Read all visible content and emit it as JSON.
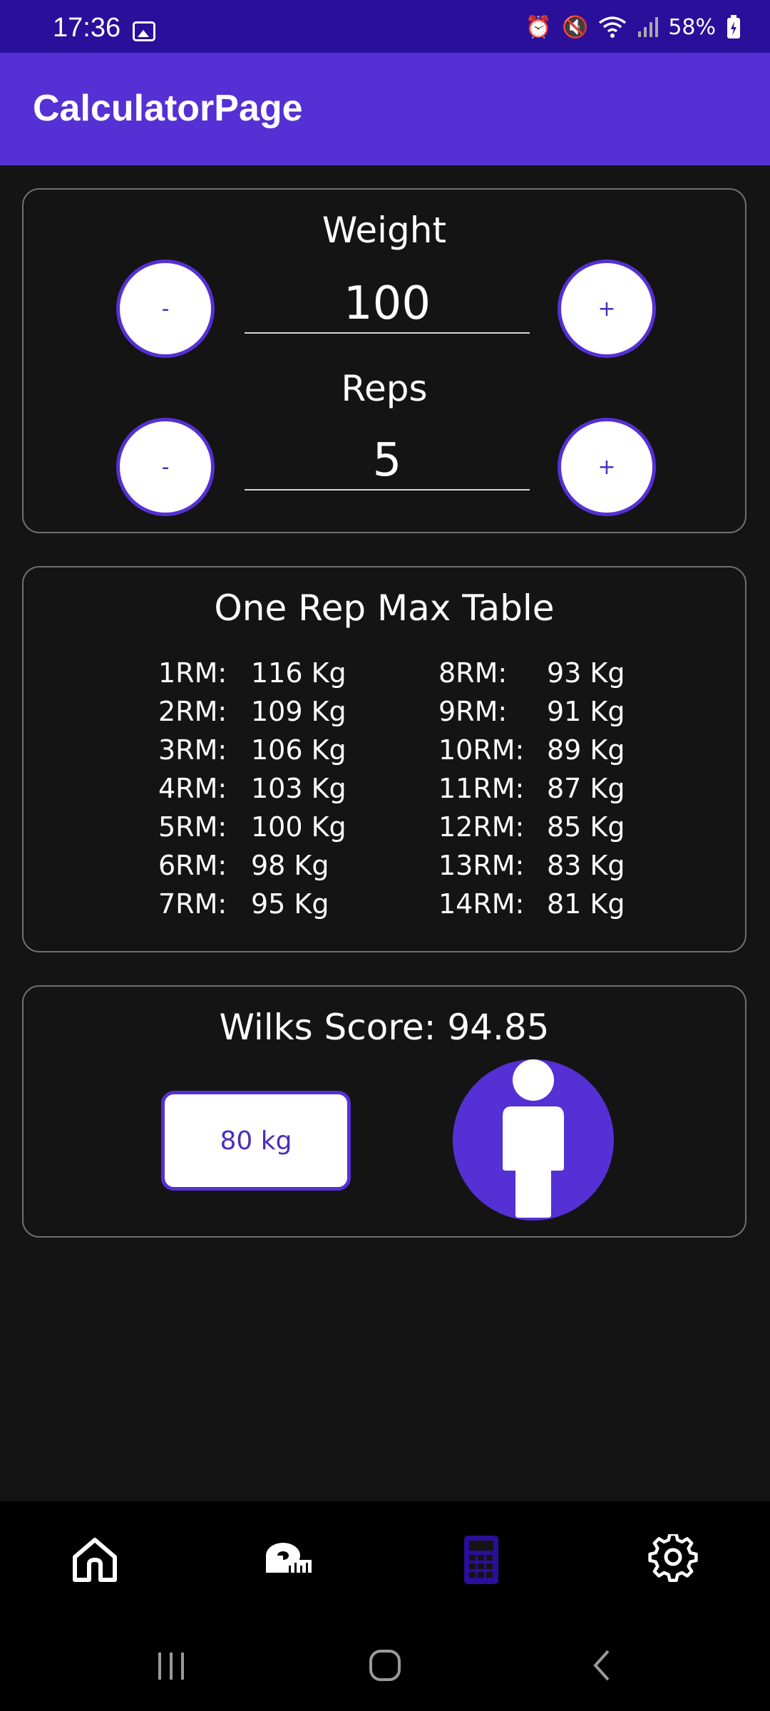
{
  "status_bar": {
    "time": "17:36",
    "battery": "58%"
  },
  "app_bar": {
    "title": "CalculatorPage"
  },
  "inputs_card": {
    "weight": {
      "label": "Weight",
      "value": "100",
      "minus": "-",
      "plus": "+"
    },
    "reps": {
      "label": "Reps",
      "value": "5",
      "minus": "-",
      "plus": "+"
    }
  },
  "rm_table": {
    "title": "One Rep Max Table",
    "left": [
      {
        "label": "1RM:",
        "value": "116 Kg"
      },
      {
        "label": "2RM:",
        "value": "109 Kg"
      },
      {
        "label": "3RM:",
        "value": "106 Kg"
      },
      {
        "label": "4RM:",
        "value": "103 Kg"
      },
      {
        "label": "5RM:",
        "value": "100 Kg"
      },
      {
        "label": "6RM:",
        "value": "98 Kg"
      },
      {
        "label": "7RM:",
        "value": "95 Kg"
      }
    ],
    "right": [
      {
        "label": "8RM:",
        "value": "93 Kg"
      },
      {
        "label": "9RM:",
        "value": "91 Kg"
      },
      {
        "label": "10RM:",
        "value": "89 Kg"
      },
      {
        "label": "11RM:",
        "value": "87 Kg"
      },
      {
        "label": "12RM:",
        "value": "85 Kg"
      },
      {
        "label": "13RM:",
        "value": "83 Kg"
      },
      {
        "label": "14RM:",
        "value": "81 Kg"
      }
    ]
  },
  "wilks": {
    "score_text": "Wilks Score: 94.85",
    "bodyweight_button": "80 kg",
    "gender_icon": "male-person-icon"
  },
  "bottom_nav": {
    "items": [
      {
        "icon": "home-icon",
        "active": false
      },
      {
        "icon": "measuring-tape-icon",
        "active": false
      },
      {
        "icon": "calculator-icon",
        "active": true
      },
      {
        "icon": "settings-gear-icon",
        "active": false
      }
    ]
  },
  "colors": {
    "accent": "#5530d4",
    "status_bar": "#2a0f9a",
    "background": "#141414",
    "nav_bg": "#000000",
    "button_text": "#4a2fb8"
  }
}
